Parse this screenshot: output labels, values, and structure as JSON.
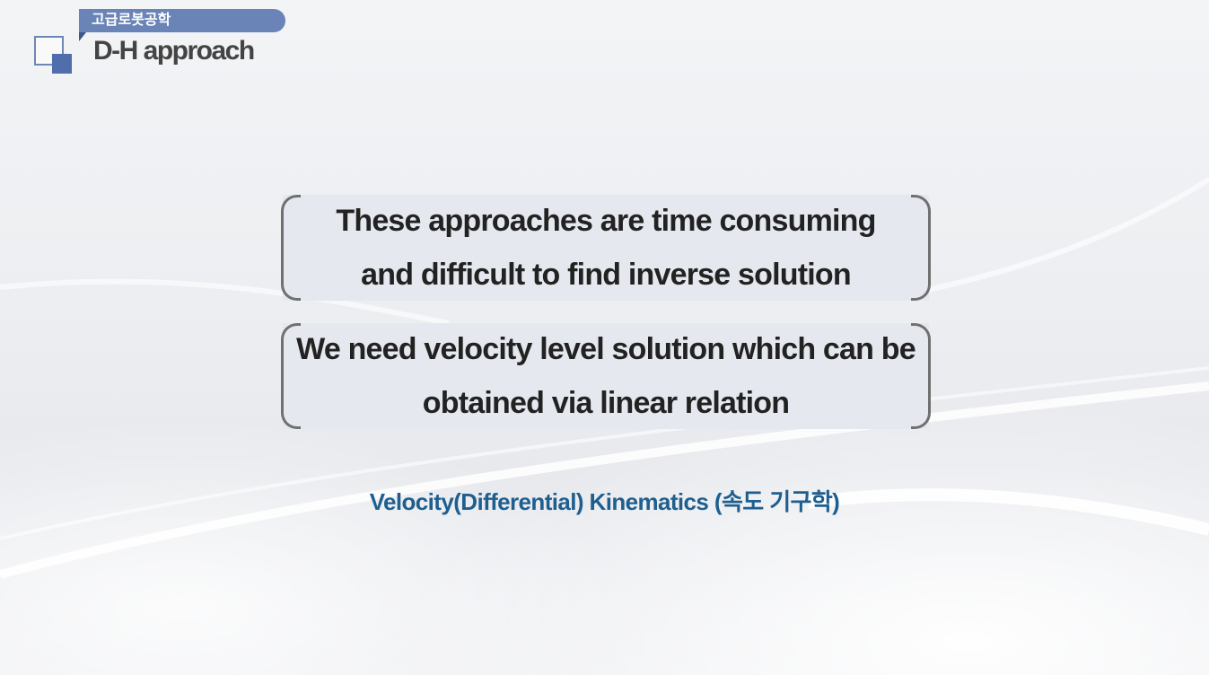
{
  "header": {
    "course_label": "고급로봇공학",
    "title": "D-H approach"
  },
  "statements": [
    {
      "line1": "These approaches are time consuming",
      "line2": "and difficult to find inverse solution"
    },
    {
      "line1": "We need velocity level solution which can be",
      "line2": "obtained via linear relation"
    }
  ],
  "conclusion": "Velocity(Differential) Kinematics (속도 기구학)",
  "colors": {
    "accent_blue": "#6a84b7",
    "conclusion_text": "#1f5f8f",
    "box_fill": "#e5e8ee"
  }
}
